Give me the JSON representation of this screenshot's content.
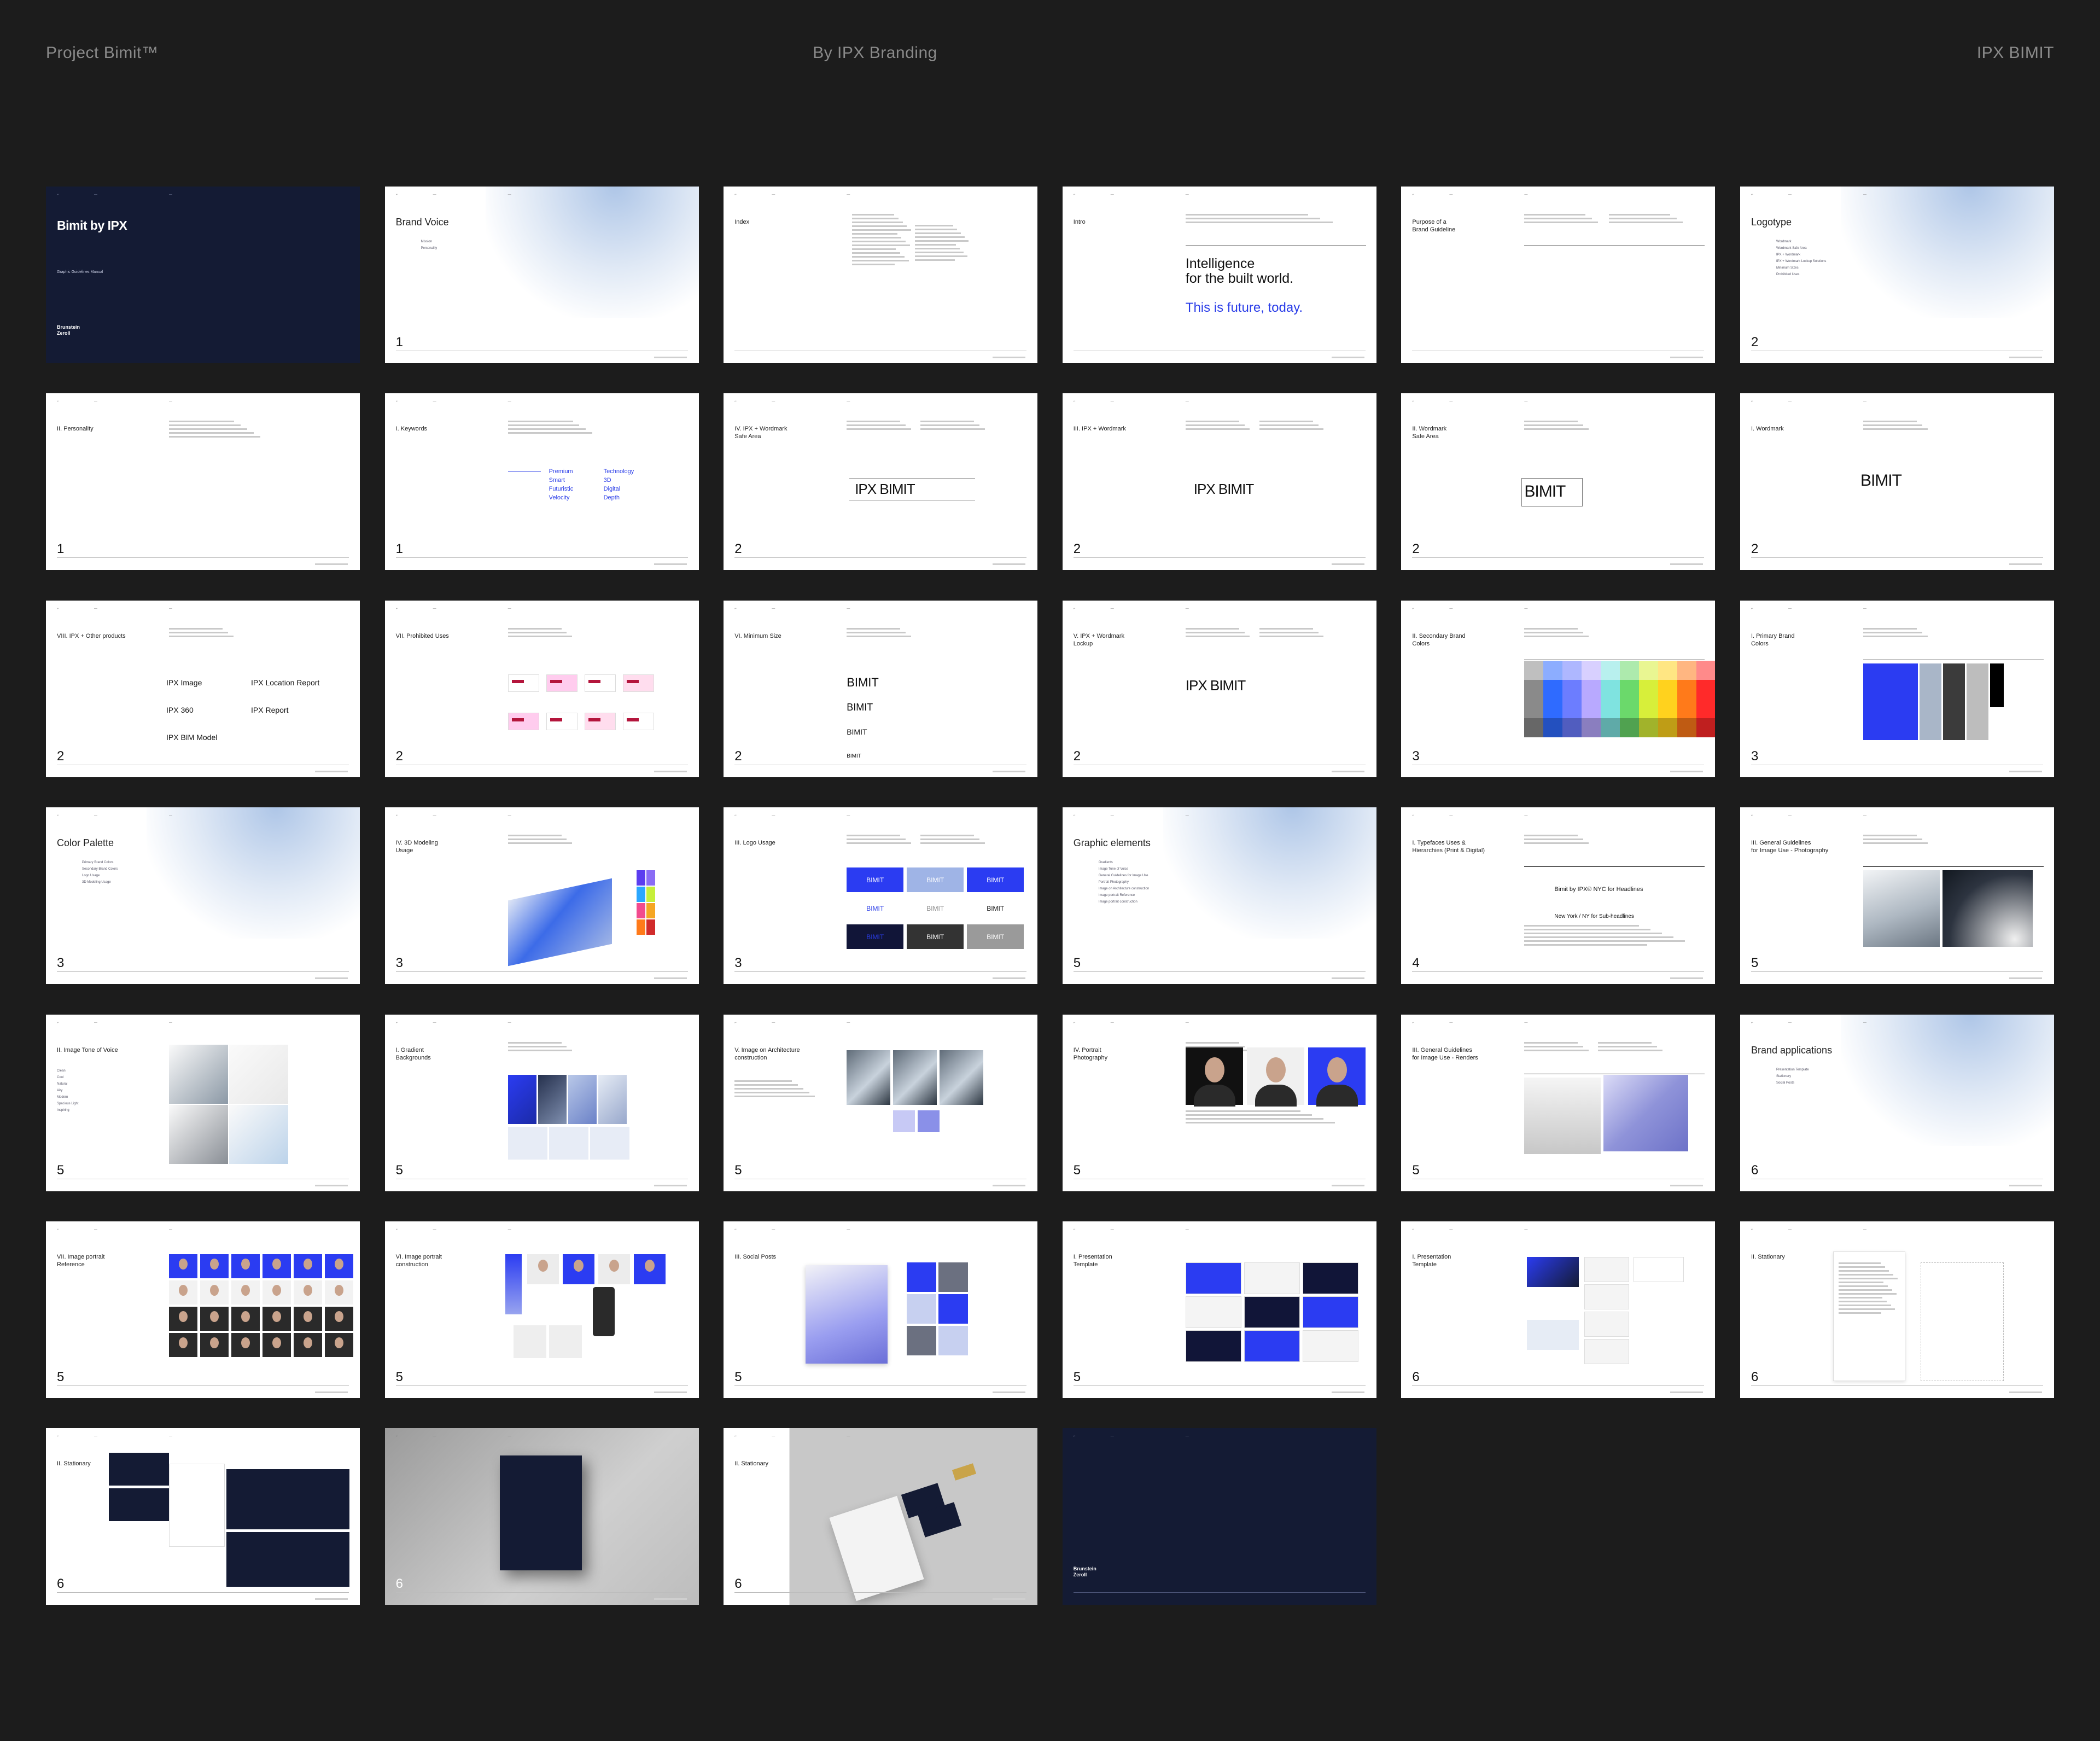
{
  "header": {
    "left": "Project Bimit™",
    "center": "By IPX Branding",
    "right": "IPX BIMIT"
  },
  "colors": {
    "background": "#1c1c1c",
    "header_text": "#8a8a8a",
    "accent_blue": "#2a3de8",
    "navy": "#141b34",
    "slide": "#ffffff"
  },
  "slides": [
    {
      "id": "s01",
      "variant": "dark",
      "title": "Bimit by IPX",
      "subtitle": "Graphic Guidelines Manual",
      "logo": "Brunstein\nZeroll"
    },
    {
      "id": "s02",
      "variant": "grad",
      "title": "Brand Voice",
      "number": "1",
      "items": [
        "Mission",
        "Personality"
      ]
    },
    {
      "id": "s03",
      "variant": "white",
      "title": "Index"
    },
    {
      "id": "s04",
      "variant": "white",
      "title": "Intro",
      "tagline": "Intelligence\nfor the built world.",
      "tagline_blue": "This is future, today."
    },
    {
      "id": "s05",
      "variant": "white",
      "title": "Purpose of a\nBrand Guideline"
    },
    {
      "id": "s06",
      "variant": "grad",
      "title": "Logotype",
      "number": "2",
      "items": [
        "Wordmark",
        "Wordmark Safe Area",
        "IPX + Wordmark",
        "IPX + Wordmark Lockup Solutions",
        "Minimum Sizes",
        "Prohibited Uses"
      ]
    },
    {
      "id": "s07",
      "variant": "white",
      "title": "II. Personality",
      "number": "1"
    },
    {
      "id": "s08",
      "variant": "white",
      "title": "I. Keywords",
      "number": "1",
      "keywords_left": "Premium\nSmart\nFuturistic\nVelocity",
      "keywords_right": "Technology\n3D\nDigital\nDepth"
    },
    {
      "id": "s09",
      "variant": "white",
      "title": "IV. IPX + Wordmark\nSafe Area",
      "number": "2",
      "mark": "IPX BIMIT"
    },
    {
      "id": "s10",
      "variant": "white",
      "title": "III. IPX + Wordmark",
      "number": "2",
      "mark": "IPX BIMIT"
    },
    {
      "id": "s11",
      "variant": "white",
      "title": "II. Wordmark\nSafe Area",
      "number": "2",
      "mark": "BIMIT"
    },
    {
      "id": "s12",
      "variant": "white",
      "title": "I. Wordmark",
      "number": "2",
      "mark": "BIMIT"
    },
    {
      "id": "s13",
      "variant": "white",
      "title": "VIII. IPX + Other products",
      "number": "2",
      "products": [
        "IPX Image",
        "IPX Location Report",
        "IPX 360",
        "IPX Report",
        "IPX BIM Model"
      ]
    },
    {
      "id": "s14",
      "variant": "white",
      "title": "VII. Prohibited Uses",
      "number": "2"
    },
    {
      "id": "s15",
      "variant": "white",
      "title": "VI. Minimum Size",
      "number": "2",
      "mark": "BIMIT"
    },
    {
      "id": "s16",
      "variant": "white",
      "title": "V. IPX + Wordmark\nLockup",
      "number": "2",
      "mark": "IPX BIMIT"
    },
    {
      "id": "s17",
      "variant": "white",
      "title": "II. Secondary Brand\nColors",
      "number": "3"
    },
    {
      "id": "s18",
      "variant": "white",
      "title": "I. Primary Brand\nColors",
      "number": "3"
    },
    {
      "id": "s19",
      "variant": "grad",
      "title": "Color Palette",
      "number": "3",
      "items": [
        "Primary Brand Colors",
        "Secondary Brand Colors",
        "Logo Usage",
        "3D Modeling Usage"
      ]
    },
    {
      "id": "s20",
      "variant": "white",
      "title": "IV. 3D Modeling\nUsage",
      "number": "3"
    },
    {
      "id": "s21",
      "variant": "white",
      "title": "III. Logo Usage",
      "number": "3",
      "mark": "BIMIT"
    },
    {
      "id": "s22",
      "variant": "grad",
      "title": "Graphic elements",
      "number": "5",
      "items": [
        "Gradients",
        "Image Tone of Voice",
        "General Guidelines for Image Use",
        "Portrait Photography",
        "Image on Architecture construction",
        "Image portrait Reference",
        "Image portrait construction"
      ]
    },
    {
      "id": "s23",
      "variant": "white",
      "title": "I. Typefaces Uses &\nHierarchies (Print & Digital)",
      "number": "4",
      "type_line1": "Bimit by IPX® NYC for Headlines",
      "type_line2": "New York / NY for Sub-headlines"
    },
    {
      "id": "s24",
      "variant": "white",
      "title": "III. General Guidelines\nfor Image Use - Photography",
      "number": "5"
    },
    {
      "id": "s25",
      "variant": "white",
      "title": "II. Image Tone of Voice",
      "number": "5",
      "items": [
        "Clean",
        "Cool",
        "Natural",
        "Airy",
        "Modern",
        "Spacious Light",
        "Inspiring"
      ]
    },
    {
      "id": "s26",
      "variant": "white",
      "title": "I. Gradient\nBackgrounds",
      "number": "5"
    },
    {
      "id": "s27",
      "variant": "white",
      "title": "V. Image on Architecture\nconstruction",
      "number": "5"
    },
    {
      "id": "s28",
      "variant": "white",
      "title": "IV. Portrait\nPhotography",
      "number": "5"
    },
    {
      "id": "s29",
      "variant": "white",
      "title": "III. General Guidelines\nfor Image Use - Renders",
      "number": "5"
    },
    {
      "id": "s30",
      "variant": "grad",
      "title": "Brand applications",
      "number": "6",
      "items": [
        "Presentation Template",
        "Stationery",
        "Social Posts"
      ]
    },
    {
      "id": "s31",
      "variant": "white",
      "title": "VII. Image portrait\nReference",
      "number": "5"
    },
    {
      "id": "s32",
      "variant": "white",
      "title": "VI. Image portrait\nconstruction",
      "number": "5"
    },
    {
      "id": "s33",
      "variant": "white",
      "title": "III. Social Posts",
      "number": "5"
    },
    {
      "id": "s34",
      "variant": "white",
      "title": "I. Presentation\nTemplate",
      "number": "5"
    },
    {
      "id": "s35",
      "variant": "white",
      "title": "I. Presentation\nTemplate",
      "number": "6"
    },
    {
      "id": "s36",
      "variant": "white",
      "title": "II. Stationary",
      "number": "6"
    },
    {
      "id": "s37",
      "variant": "white",
      "title": "II. Stationary",
      "number": "6"
    },
    {
      "id": "s38",
      "variant": "gray",
      "title": "",
      "number": "6"
    },
    {
      "id": "s39",
      "variant": "split",
      "title": "II. Stationary",
      "number": "6"
    },
    {
      "id": "s40",
      "variant": "dark",
      "title": "",
      "logo": "Brunstein\nZeroll"
    }
  ]
}
